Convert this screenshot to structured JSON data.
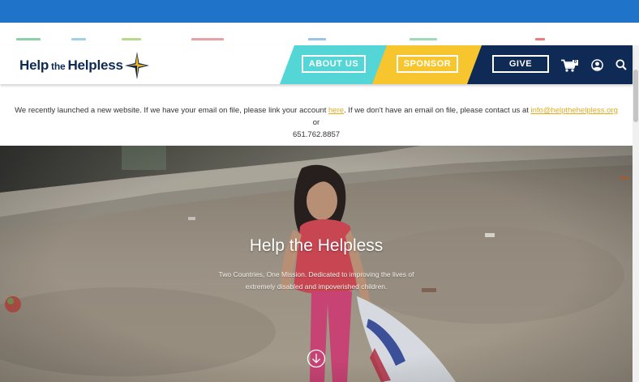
{
  "header": {
    "logo_left": "Help",
    "logo_the": "the",
    "logo_right": "Helpless",
    "nav": {
      "about_label": "ABOUT US",
      "sponsor_label": "SPONSOR",
      "give_label": "GIVE"
    },
    "cart_count": "0",
    "icons": [
      "cart-icon",
      "user-icon",
      "search-icon"
    ]
  },
  "notice": {
    "text_before": "We recently launched a new website. If we have your email on file, please link your account ",
    "link_label": "here",
    "text_middle": ". If we don't have an email on file, please contact us at ",
    "email": "info@helpthehelpless.org",
    "text_after": " or",
    "phone": "651.762.8857"
  },
  "hero": {
    "title": "Help the Helpless",
    "subtitle": "Two Countries, One Mission. Dedicated to improving the lives of extremely disabled and impoverished children."
  },
  "colors": {
    "top_bar": "#1f73c9",
    "about_teal": "#55d6d6",
    "sponsor_yellow": "#f7c52d",
    "navy": "#0f2a55",
    "link_gold": "#e0ac1e"
  }
}
